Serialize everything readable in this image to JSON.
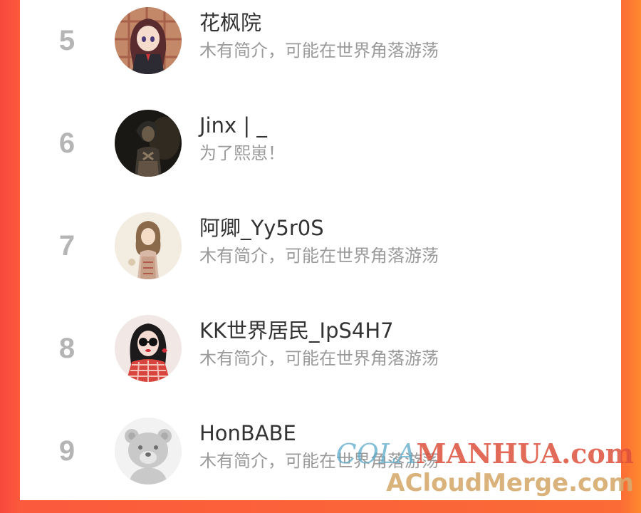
{
  "ranking": {
    "rows": [
      {
        "rank": "5",
        "name": "花枫院",
        "bio": "木有简介，可能在世界角落游荡",
        "avatar": "anime-girl-avatar"
      },
      {
        "rank": "6",
        "name": "Jinx | _",
        "bio": "为了熙崽！",
        "avatar": "dark-character-avatar"
      },
      {
        "rank": "7",
        "name": "阿卿_Yy5r0S",
        "bio": "木有简介，可能在世界角落游荡",
        "avatar": "illustrated-girl-avatar"
      },
      {
        "rank": "8",
        "name": "KK世界居民_IpS4H7",
        "bio": "木有简介，可能在世界角落游荡",
        "avatar": "sunglasses-girl-avatar"
      },
      {
        "rank": "9",
        "name": "HonBABE",
        "bio": "木有简介，可能在世界角落游荡",
        "avatar": "default-bear-avatar"
      }
    ]
  },
  "watermark": {
    "prefix": "COLA",
    "accent": "MANHUA",
    "suffix": ".com",
    "line2": "ACloudMerge.com"
  },
  "colors": {
    "rank_text": "#b5b5b5",
    "name_text": "#333333",
    "bio_text": "#9a9a9a",
    "frame_left": "#f9473e",
    "frame_right": "#ff8a2e"
  }
}
